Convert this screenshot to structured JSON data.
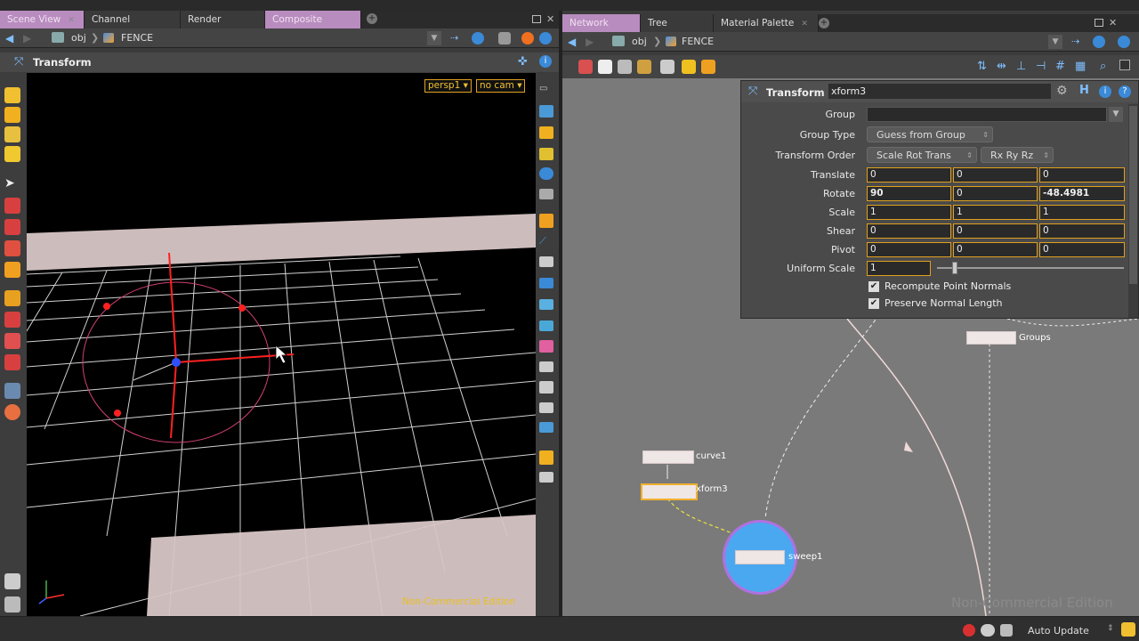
{
  "left_pane": {
    "tabs": [
      {
        "label": "Scene View",
        "active": true
      },
      {
        "label": "Channel Editor",
        "active": false
      },
      {
        "label": "Render View",
        "active": false
      },
      {
        "label": "Composite View",
        "active": true
      }
    ],
    "path": {
      "root": "obj",
      "node": "FENCE"
    },
    "viewer_title": "Transform",
    "camera_menu": "persp1 ▾",
    "cam_menu": "no cam ▾",
    "watermark": "Non-Commercial Edition"
  },
  "right_pane": {
    "tabs": [
      {
        "label": "Network View",
        "active": true
      },
      {
        "label": "Tree View",
        "active": false
      },
      {
        "label": "Material Palette",
        "active": false
      }
    ],
    "path": {
      "root": "obj",
      "node": "FENCE"
    },
    "watermark": "Non-Commercial Edition"
  },
  "params": {
    "op_type": "Transform",
    "op_name": "xform3",
    "group_label": "Group",
    "group_value": "",
    "group_type_label": "Group Type",
    "group_type_value": "Guess from Group",
    "order_label": "Transform Order",
    "order_value": "Scale Rot Trans",
    "rot_order_value": "Rx Ry Rz",
    "translate_label": "Translate",
    "translate": [
      "0",
      "0",
      "0"
    ],
    "rotate_label": "Rotate",
    "rotate": [
      "90",
      "0",
      "-48.4981"
    ],
    "scale_label": "Scale",
    "scale": [
      "1",
      "1",
      "1"
    ],
    "shear_label": "Shear",
    "shear": [
      "0",
      "0",
      "0"
    ],
    "pivot_label": "Pivot",
    "pivot": [
      "0",
      "0",
      "0"
    ],
    "uniform_label": "Uniform Scale",
    "uniform_value": "1",
    "uniform_scale_fraction": 0.1,
    "check1": "Recompute Point Normals",
    "check2": "Preserve Normal Length"
  },
  "network": {
    "nodes": {
      "curve": "curve1",
      "xform": "xform3",
      "sweep": "sweep1",
      "groups": "Groups"
    }
  },
  "status": {
    "update_mode": "Auto Update"
  },
  "colors": {
    "accent": "#e0a020",
    "tab_active": "#b98cbf",
    "selected_node": "#f0b030",
    "sweep_node": "#4aa8f0"
  }
}
